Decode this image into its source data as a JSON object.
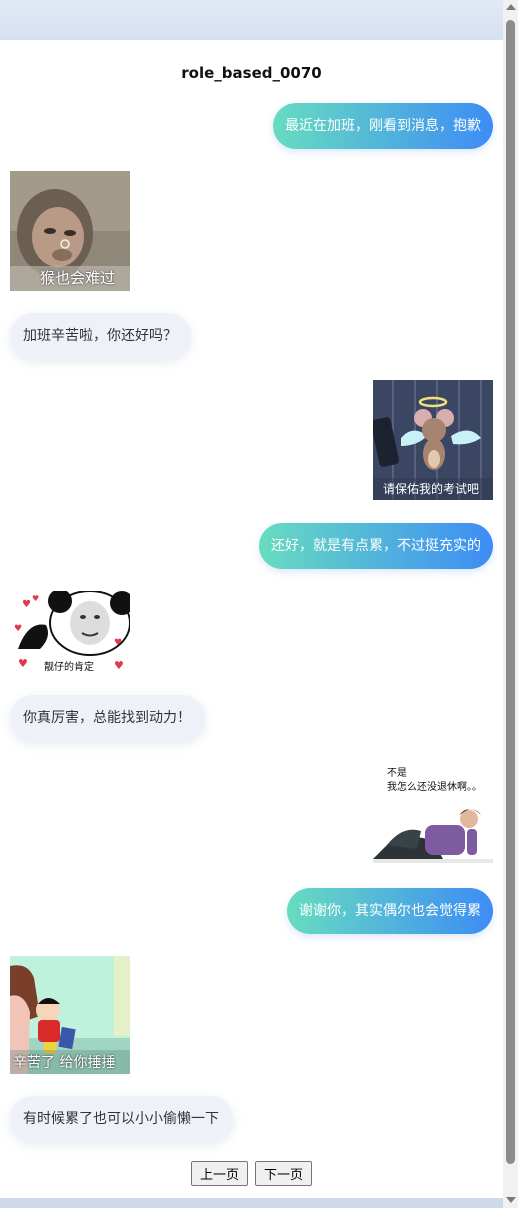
{
  "title": "role_based_0070",
  "messages": [
    {
      "text": "最近在加班，刚看到消息，抱歉"
    },
    {
      "caption": "猴也会难过"
    },
    {
      "text": "加班辛苦啦，你还好吗？"
    },
    {
      "caption": "请保佑我的考试吧"
    },
    {
      "text": "还好，就是有点累，不过挺充实的"
    },
    {
      "caption": "靓仔的肯定"
    },
    {
      "text": "你真厉害，总能找到动力！"
    },
    {
      "caption_line1": "不是",
      "caption_line2": "我怎么还没退休啊。。"
    },
    {
      "text": "谢谢你，其实偶尔也会觉得累"
    },
    {
      "caption": "辛苦了 给你捶捶"
    },
    {
      "text": "有时候累了也可以小小偷懒一下"
    }
  ],
  "pager": {
    "prev": "上一页",
    "next": "下一页"
  },
  "colors": {
    "bubble_start": "#67dcc0",
    "bubble_end": "#3d8cf5",
    "left_bubble": "#eef2f8"
  }
}
